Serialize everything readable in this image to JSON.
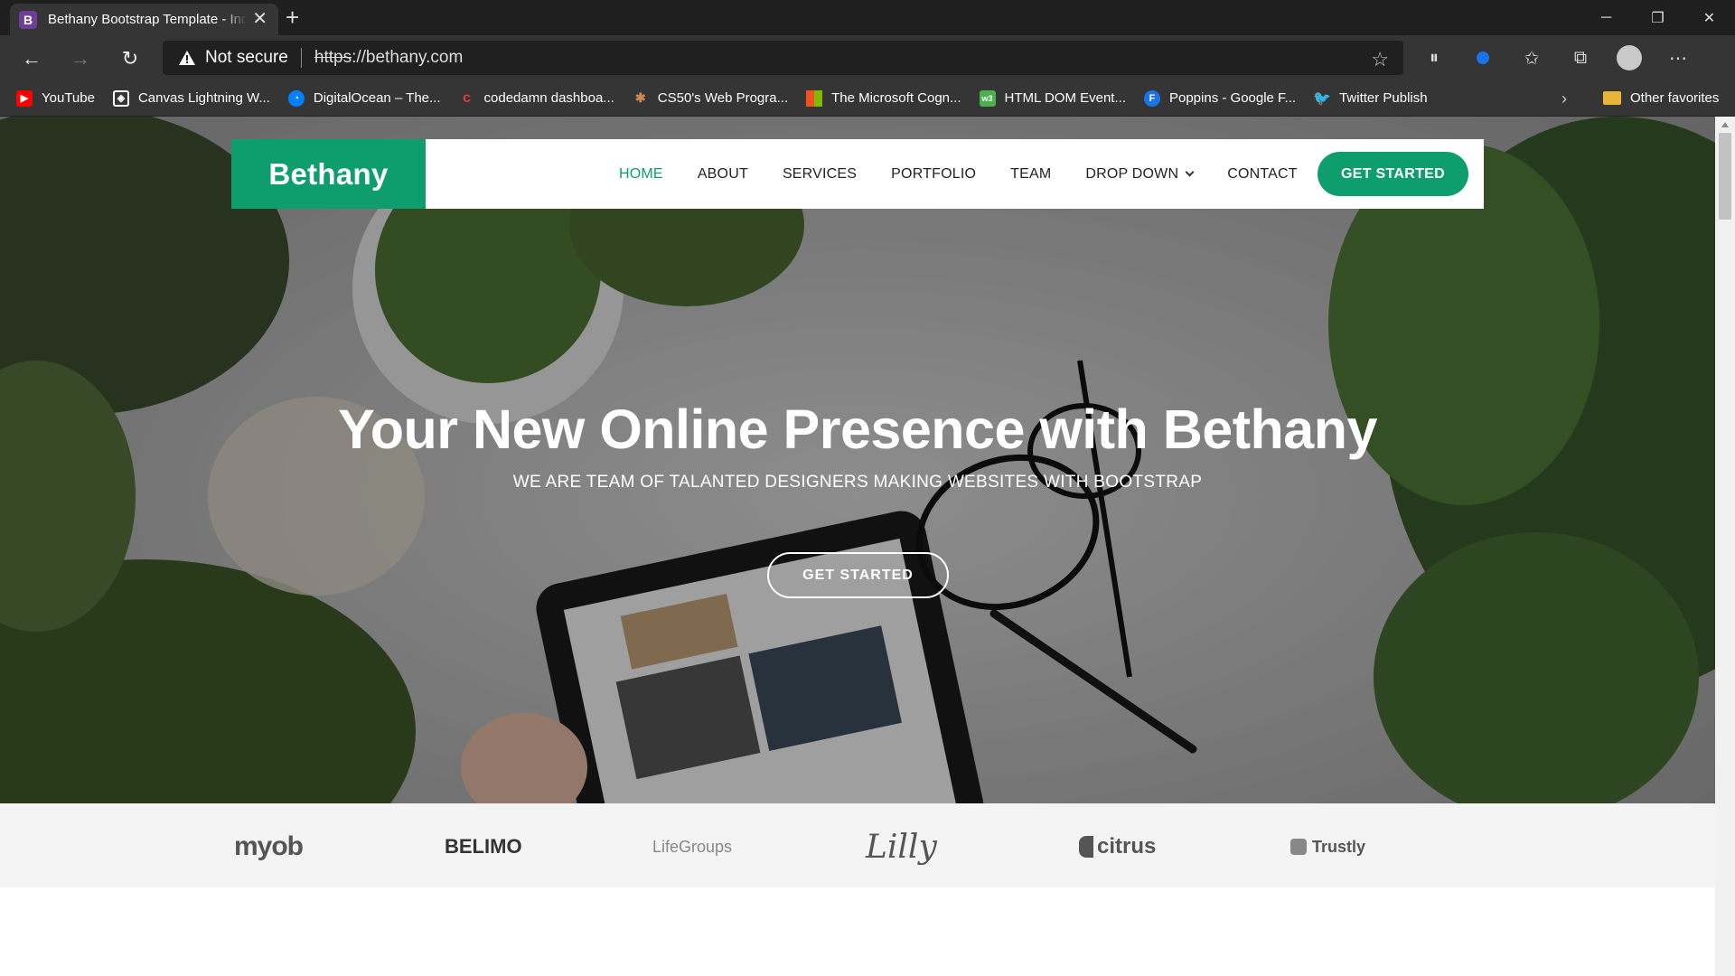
{
  "browser": {
    "tab": {
      "favicon_letter": "B",
      "title": "Bethany Bootstrap Template - Index"
    },
    "address": {
      "security_label": "Not secure",
      "url_scheme": "https",
      "url_rest": "://bethany.com"
    },
    "bookmarks": [
      {
        "label": "YouTube",
        "icon": "youtube-icon",
        "color": "#ff0000"
      },
      {
        "label": "Canvas Lightning W...",
        "icon": "canvas-icon",
        "color": "#ffffff"
      },
      {
        "label": "DigitalOcean – The...",
        "icon": "digitalocean-icon",
        "color": "#0080ff"
      },
      {
        "label": "codedamn dashboa...",
        "icon": "codedamn-icon",
        "color": "#e23b3b"
      },
      {
        "label": "CS50's Web Progra...",
        "icon": "cs50-icon",
        "color": "#a0522d"
      },
      {
        "label": "The Microsoft Cogn...",
        "icon": "microsoft-icon",
        "color": "#f25022"
      },
      {
        "label": "HTML DOM Event...",
        "icon": "w3schools-icon",
        "color": "#4caf50"
      },
      {
        "label": "Poppins - Google F...",
        "icon": "google-fonts-icon",
        "color": "#1a73e8"
      },
      {
        "label": "Twitter Publish",
        "icon": "twitter-icon",
        "color": "#1da1f2"
      }
    ],
    "other_favorites": "Other favorites"
  },
  "site": {
    "logo": "Bethany",
    "brand_color": "#0e9e6e",
    "menu": [
      "HOME",
      "ABOUT",
      "SERVICES",
      "PORTFOLIO",
      "TEAM",
      "DROP DOWN",
      "CONTACT"
    ],
    "active_menu": "HOME",
    "nav_cta": "GET STARTED",
    "hero": {
      "title": "Your New Online Presence with Bethany",
      "subtitle": "WE ARE TEAM OF TALANTED DESIGNERS MAKING WEBSITES WITH BOOTSTRAP",
      "cta": "GET STARTED"
    },
    "clients": [
      {
        "name": "myob"
      },
      {
        "name": "BELIMO"
      },
      {
        "name": "LifeGroups"
      },
      {
        "name": "Lilly"
      },
      {
        "name": "citrus"
      },
      {
        "name": "Trustly"
      }
    ]
  }
}
